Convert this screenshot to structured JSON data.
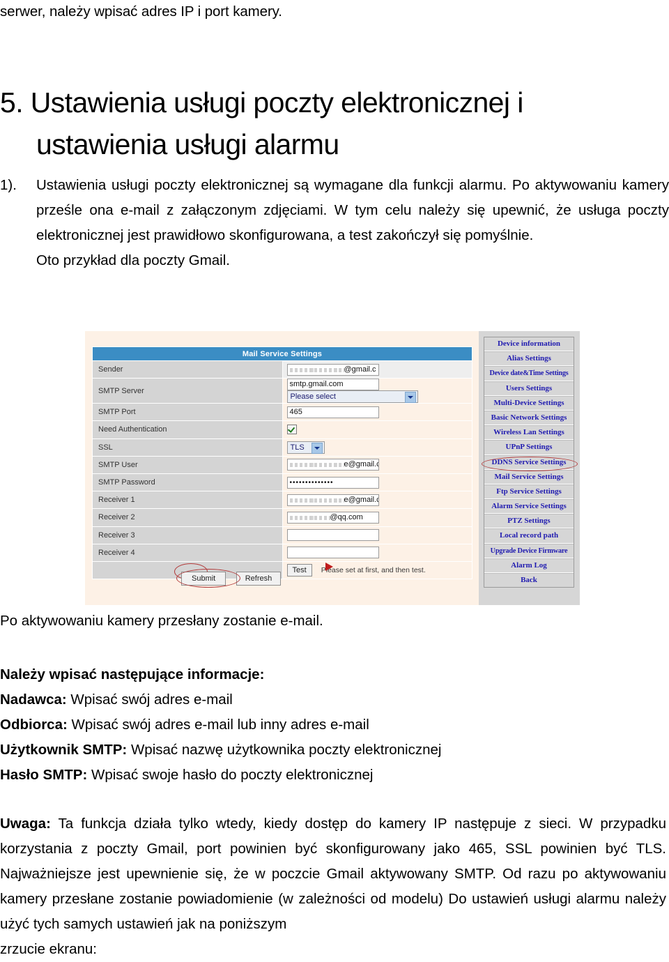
{
  "document": {
    "runover_line": "serwer, należy wpisać adres IP i port kamery.",
    "heading_line1": "5. Ustawienia usługi poczty elektronicznej i",
    "heading_line2": "ustawienia usługi alarmu",
    "list_marker": "1).",
    "list_paragraph": "Ustawienia usługi poczty elektronicznej są wymagane dla funkcji alarmu. Po aktywowaniu kamery prześle ona e-mail z załączonym zdjęciami. W tym celu należy się upewnić, że usługa poczty elektronicznej jest prawidłowo skonfigurowana, a test zakończył się pomyślnie.",
    "list_paragraph_last": "Oto przykład dla poczty Gmail.",
    "after_image_text": "Po aktywowaniu kamery przesłany zostanie e-mail.",
    "bullets_heading": "Należy wpisać następujące informacje:",
    "bullets": [
      {
        "term": "Nadawca:",
        "text": " Wpisać swój adres e-mail"
      },
      {
        "term": "Odbiorca:",
        "text": " Wpisać swój adres e-mail lub inny adres e-mail"
      },
      {
        "term": "Użytkownik SMTP:",
        "text": " Wpisać nazwę użytkownika poczty elektronicznej"
      },
      {
        "term": "Hasło SMTP:",
        "text": " Wpisać swoje hasło do poczty elektronicznej"
      }
    ],
    "note_term": "Uwaga:",
    "note_body": " Ta funkcja działa tylko wtedy, kiedy dostęp do kamery IP następuje z sieci. W przypadku korzystania z poczty Gmail, port powinien być skonfigurowany jako 465, SSL powinien być TLS. Najważniejsze jest upewnienie się, że w poczcie Gmail aktywowany SMTP. Od razu po aktywowaniu kamery przesłane zostanie powiadomienie (w zależności od modelu) Do ustawień usługi alarmu należy użyć tych samych ustawień jak na poniższym",
    "note_last": "zrzucie ekranu:"
  },
  "screenshot": {
    "panel_title": "Mail Service Settings",
    "colors": {
      "header_blue": "#3b8dc4",
      "page_cream": "#fdf1e6",
      "label_grey": "#d4d4d4",
      "nav_grey": "#d6d6d6",
      "nav_link_blue": "#201bb0",
      "annotation_red": "#b23b3b"
    },
    "rows": [
      {
        "label": "Sender",
        "kind": "redacted",
        "value": "@gmail.c"
      },
      {
        "label": "SMTP Server",
        "kind": "text+select",
        "value": "smtp.gmail.com",
        "select": "Please select"
      },
      {
        "label": "SMTP Port",
        "kind": "text",
        "value": "465"
      },
      {
        "label": "Need Authentication",
        "kind": "checkbox",
        "value": "checked"
      },
      {
        "label": "SSL",
        "kind": "select",
        "select": "TLS"
      },
      {
        "label": "SMTP User",
        "kind": "redacted",
        "value": "e@gmail.c"
      },
      {
        "label": "SMTP Password",
        "kind": "password",
        "value": "••••••••••••••"
      },
      {
        "label": "Receiver 1",
        "kind": "redacted",
        "value": "e@gmail.c"
      },
      {
        "label": "Receiver 2",
        "kind": "redacted",
        "value": "@qq.com"
      },
      {
        "label": "Receiver 3",
        "kind": "text",
        "value": ""
      },
      {
        "label": "Receiver 4",
        "kind": "text",
        "value": ""
      }
    ],
    "test_button": "Test",
    "test_hint": "Please set at first, and then test.",
    "submit_button": "Submit",
    "refresh_button": "Refresh",
    "nav_items": [
      "Device information",
      "Alias Settings",
      "Device date&Time Settings",
      "Users Settings",
      "Multi-Device Settings",
      "Basic Network Settings",
      "Wireless Lan Settings",
      "UPnP Settings",
      "DDNS Service Settings",
      "Mail Service Settings",
      "Ftp Service Settings",
      "Alarm Service Settings",
      "PTZ Settings",
      "Local record path",
      "Upgrade Device Firmware",
      "Alarm Log",
      "Back"
    ],
    "highlighted_nav_item": "Mail Service Settings"
  }
}
